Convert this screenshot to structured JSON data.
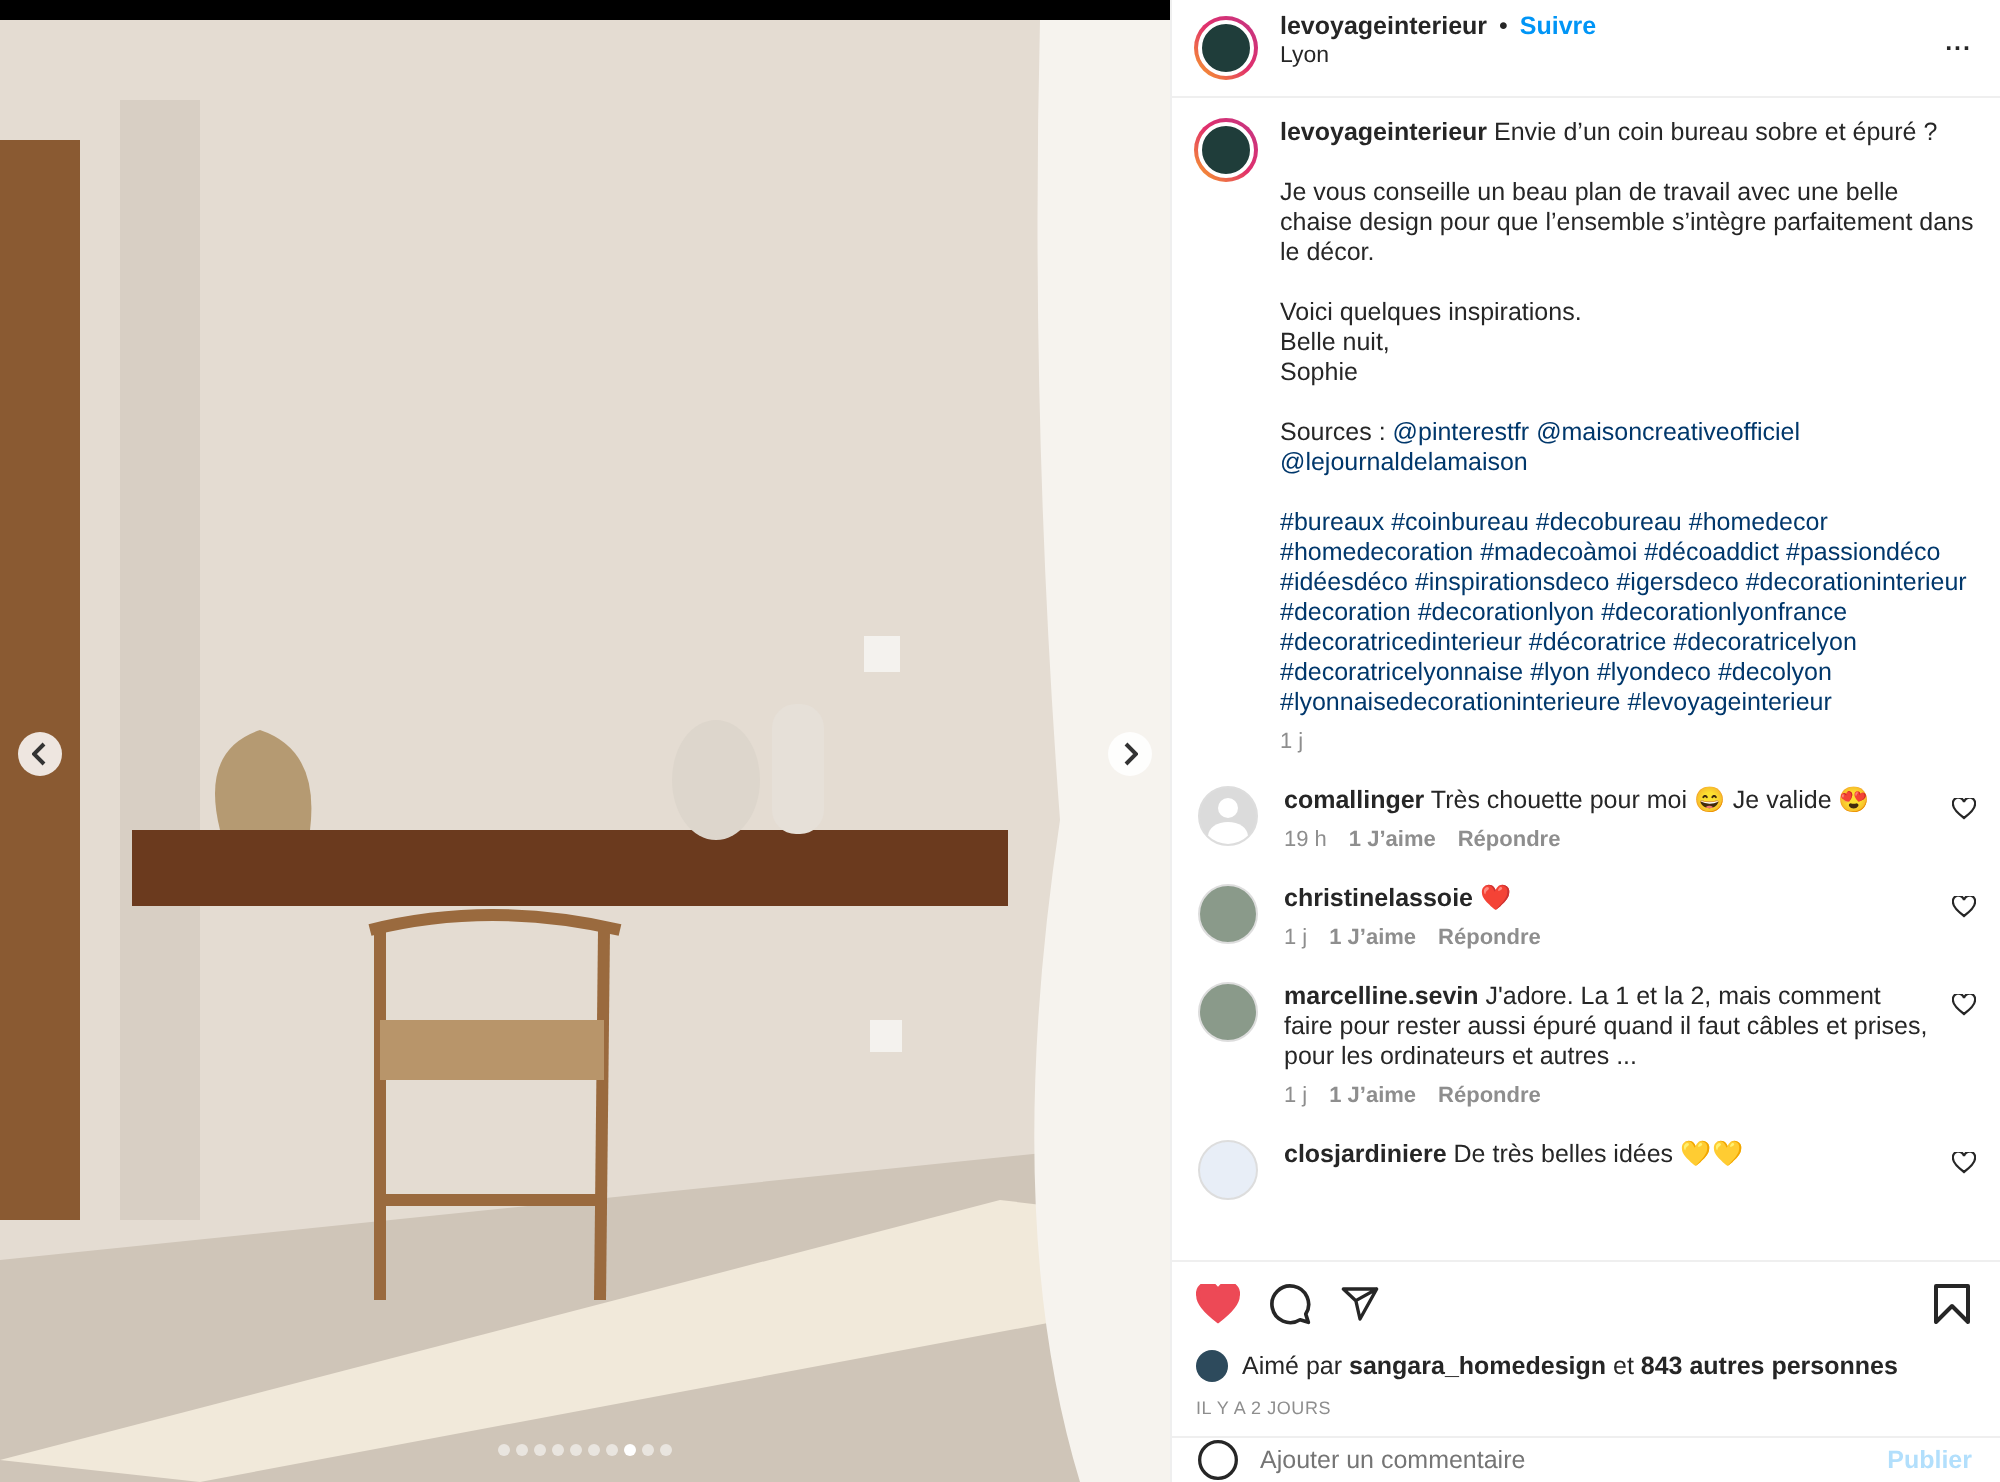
{
  "carousel": {
    "dots": [
      {
        "selected": false
      },
      {
        "selected": false
      },
      {
        "selected": false
      },
      {
        "selected": false
      },
      {
        "selected": false
      },
      {
        "selected": false
      },
      {
        "selected": false
      },
      {
        "selected": true
      },
      {
        "selected": false
      },
      {
        "selected": false
      }
    ]
  },
  "header": {
    "username": "levoyageinterieur",
    "separator": "•",
    "follow": "Suivre",
    "location": "Lyon",
    "more": "..."
  },
  "caption": {
    "username": "levoyageinterieur",
    "intro": "Envie d’un coin bureau sobre et épuré ?",
    "paragraphs": [
      [
        "Je vous conseille un beau plan de travail avec une belle chaise design pour que l’ensemble s’intègre parfaitement dans le décor."
      ],
      [
        "Voici quelques inspirations.",
        "Belle nuit,",
        "Sophie"
      ]
    ],
    "sources_label": "Sources :",
    "mentions": [
      "@pinterestfr",
      "@maisoncreativeofficiel",
      "@lejournaldelamaison"
    ],
    "hashtags": [
      "#bureaux",
      "#coinbureau",
      "#decobureau",
      "#homedecor",
      "#homedecoration",
      "#madecoàmoi",
      "#décoaddict",
      "#passiondéco",
      "#idéesdéco",
      "#inspirationsdeco",
      "#igersdeco",
      "#decorationinterieur",
      "#decoration",
      "#decorationlyon",
      "#decorationlyonfrance",
      "#decoratricedinterieur",
      "#décoratrice",
      "#decoratricelyon",
      "#decoratricelyonnaise",
      "#lyon",
      "#lyondeco",
      "#decolyon",
      "#lyonnaisedecorationinterieure",
      "#levoyageinterieur"
    ],
    "time": "1 j"
  },
  "comments": [
    {
      "kind": "silhouette",
      "username": "comallinger",
      "text": "Très chouette pour moi 😄 Je valide 😍",
      "time": "19 h",
      "likes": "1 J’aime",
      "reply": "Répondre"
    },
    {
      "kind": "photo",
      "username": "christinelassoie",
      "text": "❤️",
      "time": "1 j",
      "likes": "1 J’aime",
      "reply": "Répondre"
    },
    {
      "kind": "photo",
      "username": "marcelline.sevin",
      "text": "J'adore. La 1 et la 2, mais comment faire pour rester aussi épuré quand il faut câbles et prises, pour les ordinateurs et autres ...",
      "time": "1 j",
      "likes": "1 J’aime",
      "reply": "Répondre"
    },
    {
      "kind": "logo",
      "username": "closjardiniere",
      "text": "De très belles idées 💛💛"
    }
  ],
  "actions": {
    "liked": true,
    "liked_by": "Aimé par **sangara_homedesign** et **843 autres personnes**",
    "date": "IL Y A 2 JOURS"
  },
  "comment_box": {
    "placeholder": "Ajouter un commentaire",
    "submit": "Publier"
  }
}
